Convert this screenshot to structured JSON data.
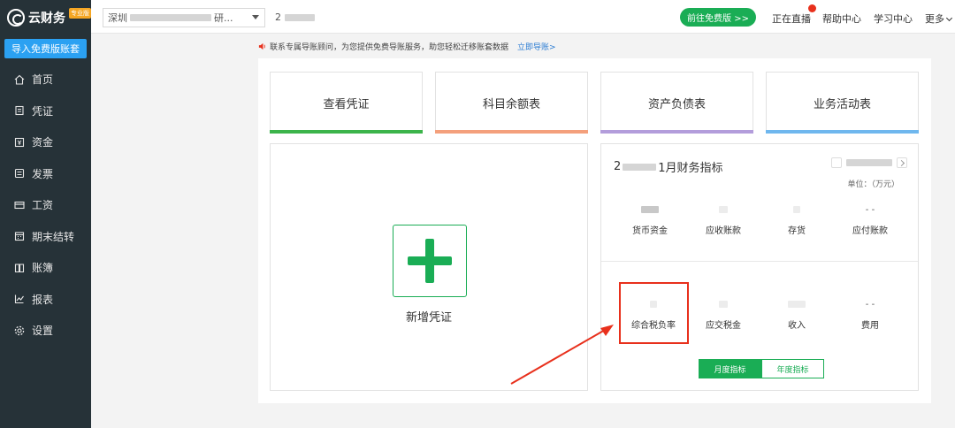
{
  "brand": {
    "name": "云财务",
    "badge": "专业版"
  },
  "sidebar": {
    "import_label": "导入免费版账套",
    "items": [
      {
        "label": "首页",
        "icon": "home-icon"
      },
      {
        "label": "凭证",
        "icon": "voucher-icon"
      },
      {
        "label": "资金",
        "icon": "fund-icon"
      },
      {
        "label": "发票",
        "icon": "invoice-icon"
      },
      {
        "label": "工资",
        "icon": "salary-icon"
      },
      {
        "label": "期末结转",
        "icon": "calendar-icon"
      },
      {
        "label": "账簿",
        "icon": "ledger-icon"
      },
      {
        "label": "报表",
        "icon": "chart-icon"
      },
      {
        "label": "设置",
        "icon": "gear-icon"
      }
    ]
  },
  "topbar": {
    "company_prefix": "深圳",
    "company_suffix": "研...",
    "period_prefix": "2",
    "free_button": "前往免费版 >>",
    "links": [
      "正在直播",
      "帮助中心",
      "学习中心",
      "更多"
    ]
  },
  "notice": {
    "text": "联系专属导账顾问，为您提供免费导账服务，助您轻松迁移账套数据",
    "link": "立即导账>"
  },
  "quick_cards": [
    {
      "label": "查看凭证",
      "color": "#3cb44b"
    },
    {
      "label": "科目余额表",
      "color": "#f4a07c"
    },
    {
      "label": "资产负债表",
      "color": "#b39ddb"
    },
    {
      "label": "业务活动表",
      "color": "#6fb7ee"
    }
  ],
  "voucher": {
    "label": "新增凭证"
  },
  "metrics": {
    "title_prefix": "2",
    "title_suffix": "1月财务指标",
    "unit": "单位：（万元）",
    "row1": [
      {
        "label": "货币资金",
        "value": ""
      },
      {
        "label": "应收账款",
        "value": ""
      },
      {
        "label": "存货",
        "value": ""
      },
      {
        "label": "应付账款",
        "value": "- -"
      }
    ],
    "row2": [
      {
        "label": "综合税负率",
        "value": ""
      },
      {
        "label": "应交税金",
        "value": ""
      },
      {
        "label": "收入",
        "value": ""
      },
      {
        "label": "费用",
        "value": "- -"
      }
    ],
    "toggle": {
      "monthly": "月度指标",
      "yearly": "年度指标"
    }
  },
  "colors": {
    "sidebar_bg": "#263238",
    "accent_green": "#1aad55",
    "highlight_red": "#e8301c",
    "link_blue": "#2b7cd3"
  }
}
